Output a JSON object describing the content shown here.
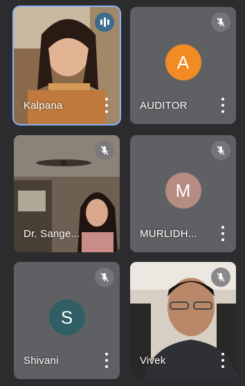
{
  "colors": {
    "background": "#2c2c2e",
    "tile": "#5f6063",
    "active_border": "#8ab4f8",
    "avatar_auditor": "#f28b24",
    "avatar_murlidhar": "#b58b82",
    "avatar_shivani": "#2f5f64"
  },
  "participants": [
    {
      "name": "Kalpana",
      "video": true,
      "speaking": true,
      "muted": false,
      "icon": "audio-level-icon"
    },
    {
      "name": "AUDITOR",
      "video": false,
      "initial": "A",
      "muted": true,
      "icon": "mic-off-icon"
    },
    {
      "name": "Dr. Sange...",
      "video": true,
      "muted": true,
      "icon": "mic-off-icon"
    },
    {
      "name": "MURLIDH...",
      "video": false,
      "initial": "M",
      "muted": true,
      "icon": "mic-off-icon"
    },
    {
      "name": "Shivani",
      "video": false,
      "initial": "S",
      "muted": true,
      "icon": "mic-off-icon"
    },
    {
      "name": "Vivek",
      "video": true,
      "muted": true,
      "icon": "mic-off-icon"
    }
  ],
  "more_icon": "more-vert-icon"
}
